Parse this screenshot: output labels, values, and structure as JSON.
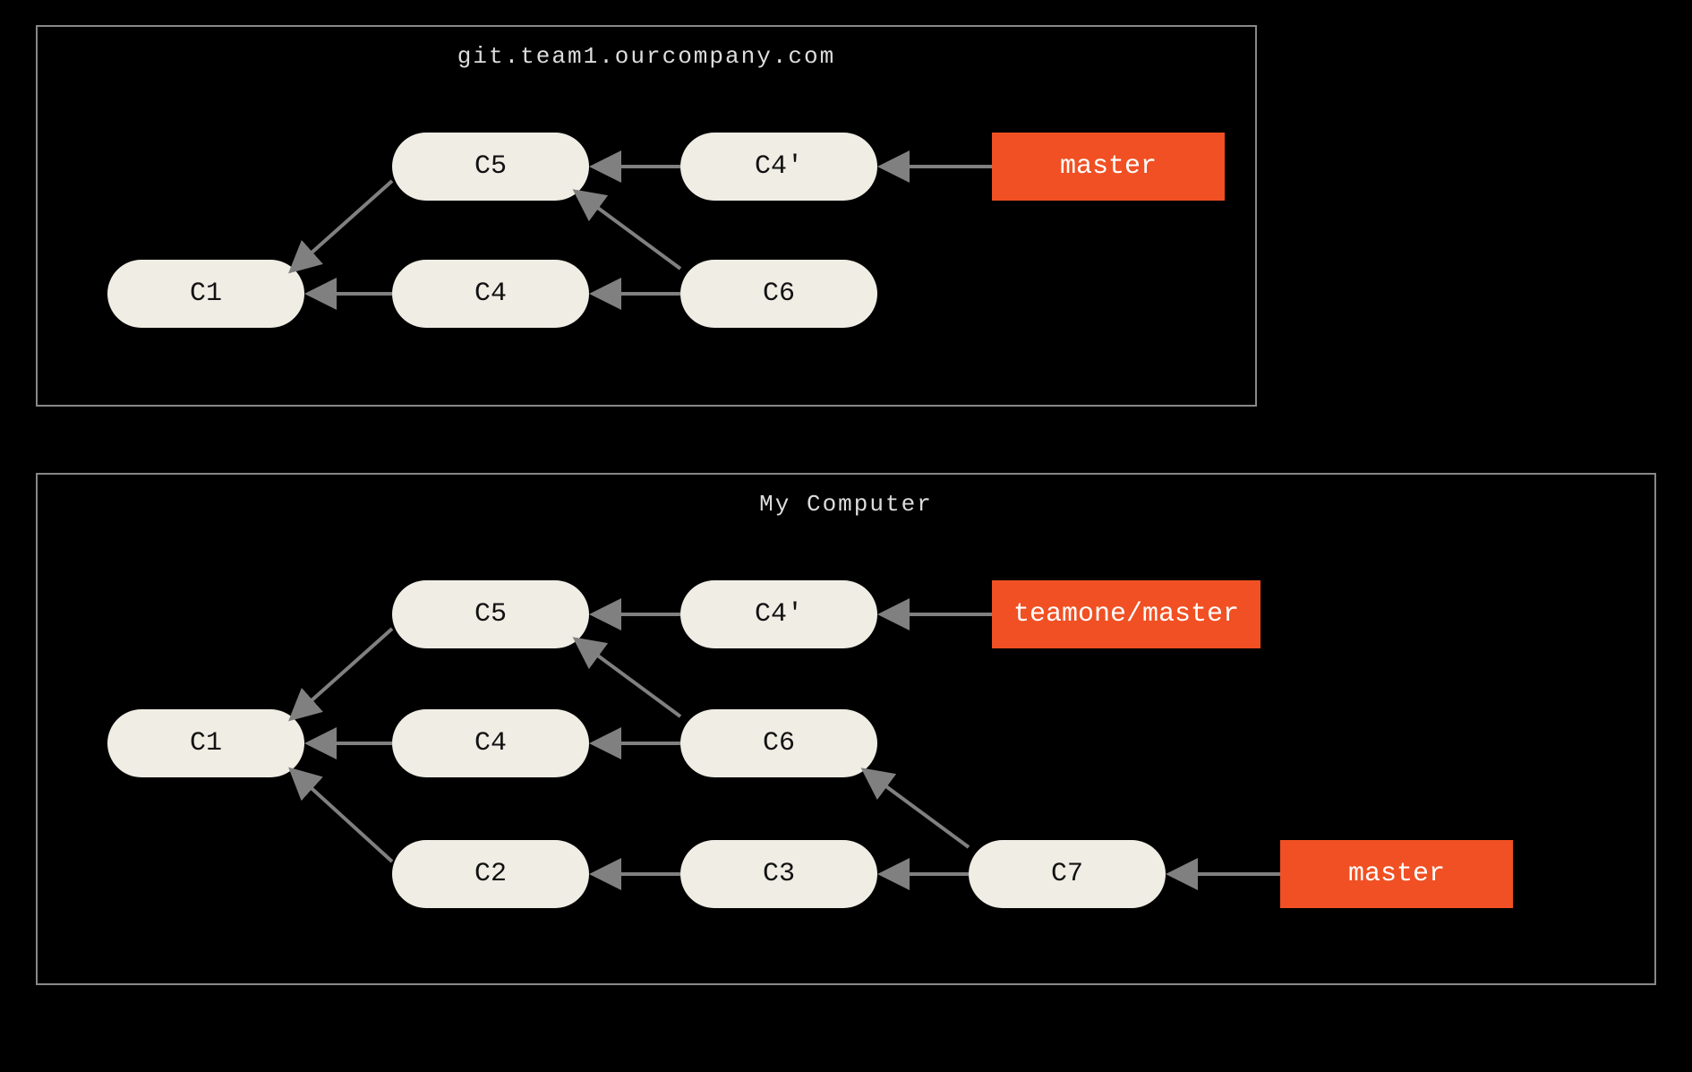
{
  "colors": {
    "branch": "#f05023",
    "commit": "#efede4",
    "border": "#888888",
    "bg": "#000000",
    "arrow": "#808080"
  },
  "panels": {
    "remote": {
      "title": "git.team1.ourcompany.com"
    },
    "local": {
      "title": "My Computer"
    }
  },
  "commits": {
    "remote": {
      "c1": "C1",
      "c5": "C5",
      "c4p": "C4'",
      "c4": "C4",
      "c6": "C6"
    },
    "local": {
      "c1": "C1",
      "c5": "C5",
      "c4p": "C4'",
      "c4": "C4",
      "c6": "C6",
      "c2": "C2",
      "c3": "C3",
      "c7": "C7"
    }
  },
  "branches": {
    "remote_master": "master",
    "teamone_master": "teamone/master",
    "local_master": "master"
  },
  "edges": {
    "remote": [
      [
        "c5",
        "c1"
      ],
      [
        "c4",
        "c1"
      ],
      [
        "c4p",
        "c5"
      ],
      [
        "c6",
        "c4"
      ],
      [
        "c6",
        "c5"
      ],
      [
        "master",
        "c4p"
      ]
    ],
    "local": [
      [
        "c5",
        "c1"
      ],
      [
        "c4",
        "c1"
      ],
      [
        "c2",
        "c1"
      ],
      [
        "c4p",
        "c5"
      ],
      [
        "c6",
        "c4"
      ],
      [
        "c6",
        "c5"
      ],
      [
        "c3",
        "c2"
      ],
      [
        "c7",
        "c3"
      ],
      [
        "c7",
        "c6"
      ],
      [
        "teamone_master",
        "c4p"
      ],
      [
        "master",
        "c7"
      ]
    ]
  }
}
